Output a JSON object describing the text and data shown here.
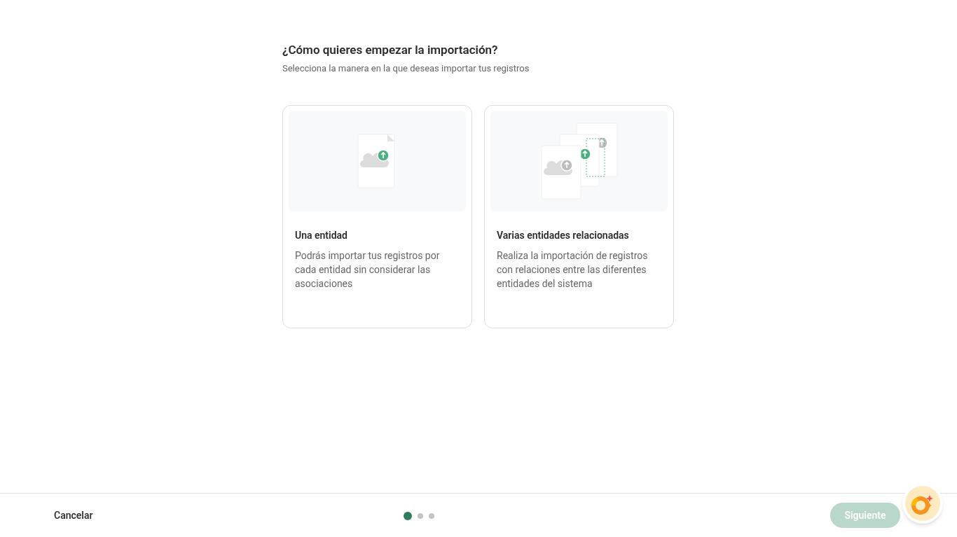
{
  "heading": {
    "title": "¿Cómo quieres empezar la importación?",
    "subtitle": "Selecciona la manera en la que deseas importar tus registros"
  },
  "options": [
    {
      "kind": "single",
      "title": "Una entidad",
      "description": "Podrás importar tus registros por cada entidad sin considerar las asociaciones",
      "selected": false
    },
    {
      "kind": "multiple",
      "title": "Varias entidades relacionadas",
      "description": "Realiza la importación de registros con relaciones entre las diferentes entidades del sistema",
      "selected": false
    }
  ],
  "footer": {
    "cancel": "Cancelar",
    "steps": [
      {
        "selected": true
      },
      {
        "selected": false
      },
      {
        "selected": false
      }
    ],
    "next": {
      "label": "Siguiente",
      "disabled": true
    }
  }
}
